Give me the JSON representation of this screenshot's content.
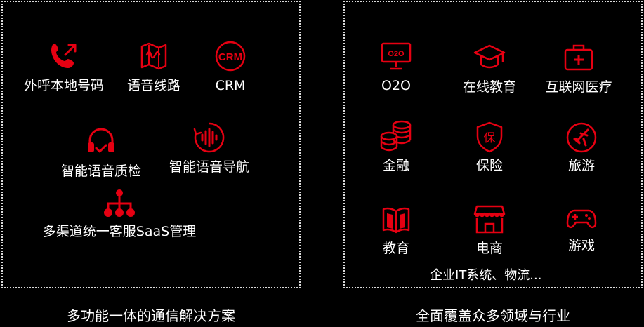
{
  "colors": {
    "accent": "#e60012",
    "background": "#000000",
    "text": "#ffffff",
    "border": "#d9d9d9"
  },
  "left": {
    "caption": "多功能一体的通信解决方案",
    "items": [
      {
        "label": "外呼本地号码",
        "icon": "phone-outgoing-icon"
      },
      {
        "label": "语音线路",
        "icon": "voice-line-icon"
      },
      {
        "label": "CRM",
        "icon": "crm-icon"
      },
      {
        "label": "智能语音质检",
        "icon": "headset-check-icon"
      },
      {
        "label": "智能语音导航",
        "icon": "voice-navigation-icon"
      },
      {
        "label": "多渠道统一客服SaaS管理",
        "icon": "network-tree-icon"
      }
    ]
  },
  "right": {
    "caption": "全面覆盖众多领域与行业",
    "items": [
      {
        "label": "O2O",
        "icon": "monitor-o2o-icon"
      },
      {
        "label": "在线教育",
        "icon": "graduation-cap-icon"
      },
      {
        "label": "互联网医疗",
        "icon": "medical-kit-icon"
      },
      {
        "label": "金融",
        "icon": "coin-stack-icon"
      },
      {
        "label": "保险",
        "icon": "insurance-shield-icon"
      },
      {
        "label": "旅游",
        "icon": "airplane-icon"
      },
      {
        "label": "教育",
        "icon": "open-book-icon"
      },
      {
        "label": "电商",
        "icon": "storefront-icon"
      },
      {
        "label": "游戏",
        "icon": "gamepad-icon"
      }
    ],
    "more": "企业IT系统、物流..."
  }
}
